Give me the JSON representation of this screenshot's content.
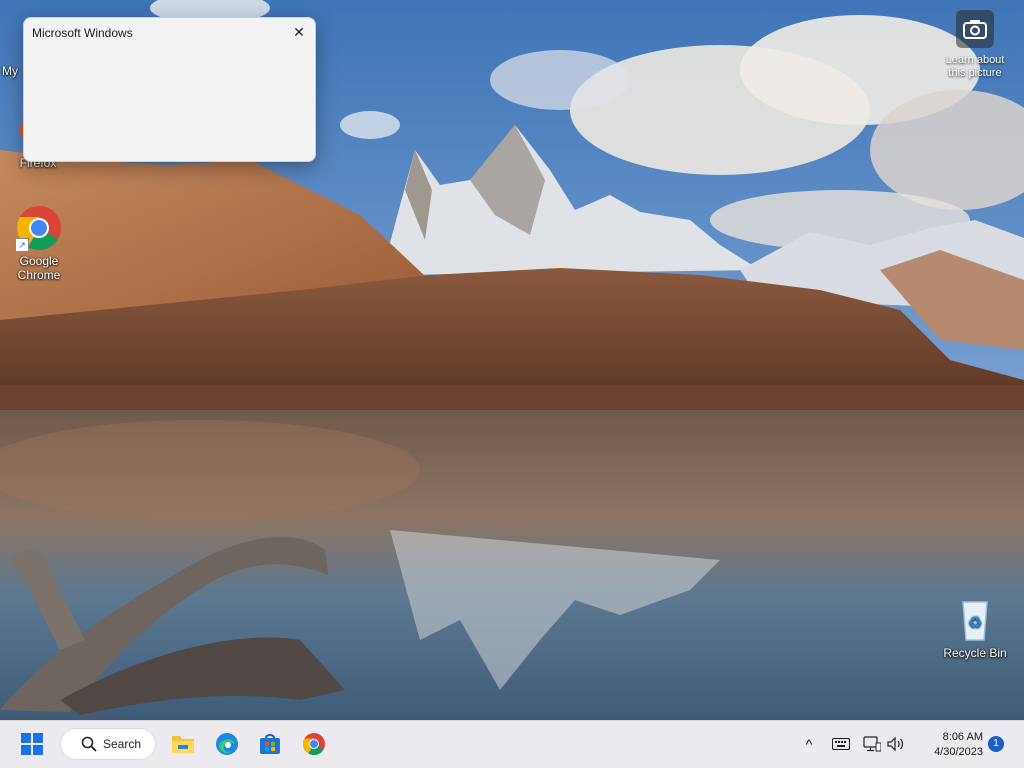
{
  "desktop": {
    "icons": [
      {
        "label": "My",
        "icon": "folder-icon"
      },
      {
        "label": "Firefox",
        "icon": "firefox-icon"
      },
      {
        "label": "Google Chrome",
        "icon": "chrome-icon"
      },
      {
        "label": "Recycle Bin",
        "icon": "recycle-bin-icon"
      }
    ],
    "learn_label": "Learn about this picture"
  },
  "dialog": {
    "title": "Microsoft Windows",
    "close_glyph": "✕"
  },
  "taskbar": {
    "search_label": "Search",
    "pinned": [
      "start-icon",
      "file-explorer-icon",
      "edge-icon",
      "store-icon",
      "chrome-icon"
    ],
    "tray": {
      "chevron_glyph": "^",
      "keyboard_icon": "keyboard-icon",
      "network_icon": "network-icon",
      "volume_icon": "volume-icon"
    },
    "time": "8:06 AM",
    "date": "4/30/2023",
    "notification_count": "1"
  },
  "colors": {
    "accent": "#1a5fc7",
    "taskbar": "#ece9ef",
    "dialog_bg": "#f3f3f3"
  }
}
